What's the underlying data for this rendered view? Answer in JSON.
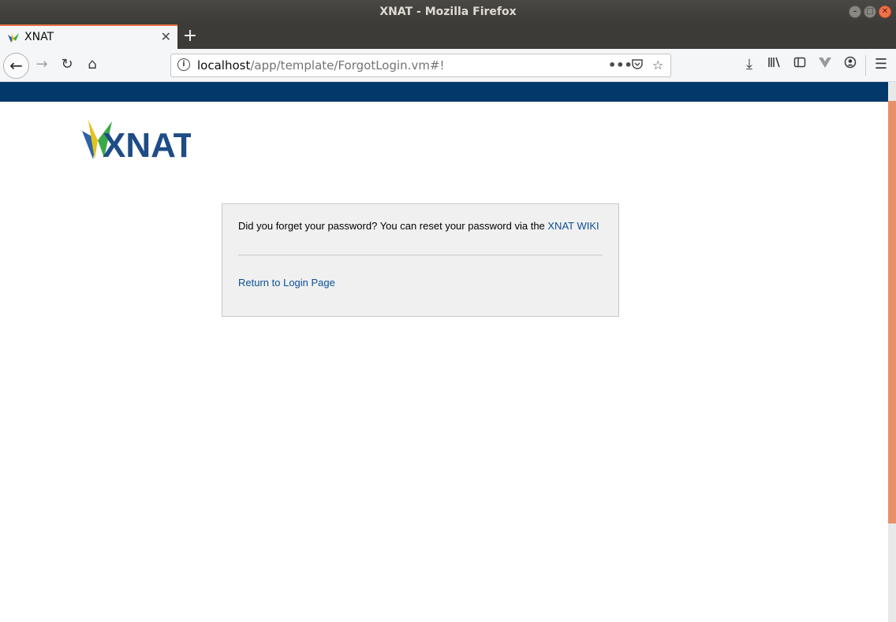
{
  "window": {
    "title": "XNAT - Mozilla Firefox"
  },
  "tabs": [
    {
      "title": "XNAT"
    }
  ],
  "urlbar": {
    "host": "localhost",
    "path": "/app/template/ForgotLogin.vm#!"
  },
  "logo": {
    "text": "XNAT"
  },
  "content": {
    "message": "Did you forget your password? You can reset your password via the ",
    "wiki_link": "XNAT WIKI",
    "return_link": "Return to Login Page"
  },
  "colors": {
    "header_band": "#03386b",
    "link": "#0a4f99",
    "accent": "#e9764b"
  },
  "icons": [
    "back-icon",
    "forward-icon",
    "reload-icon",
    "home-icon",
    "info-icon",
    "page-actions-icon",
    "pocket-icon",
    "bookmark-star-icon",
    "downloads-icon",
    "library-icon",
    "sidebar-icon",
    "extension-icon",
    "account-icon",
    "menu-icon"
  ]
}
